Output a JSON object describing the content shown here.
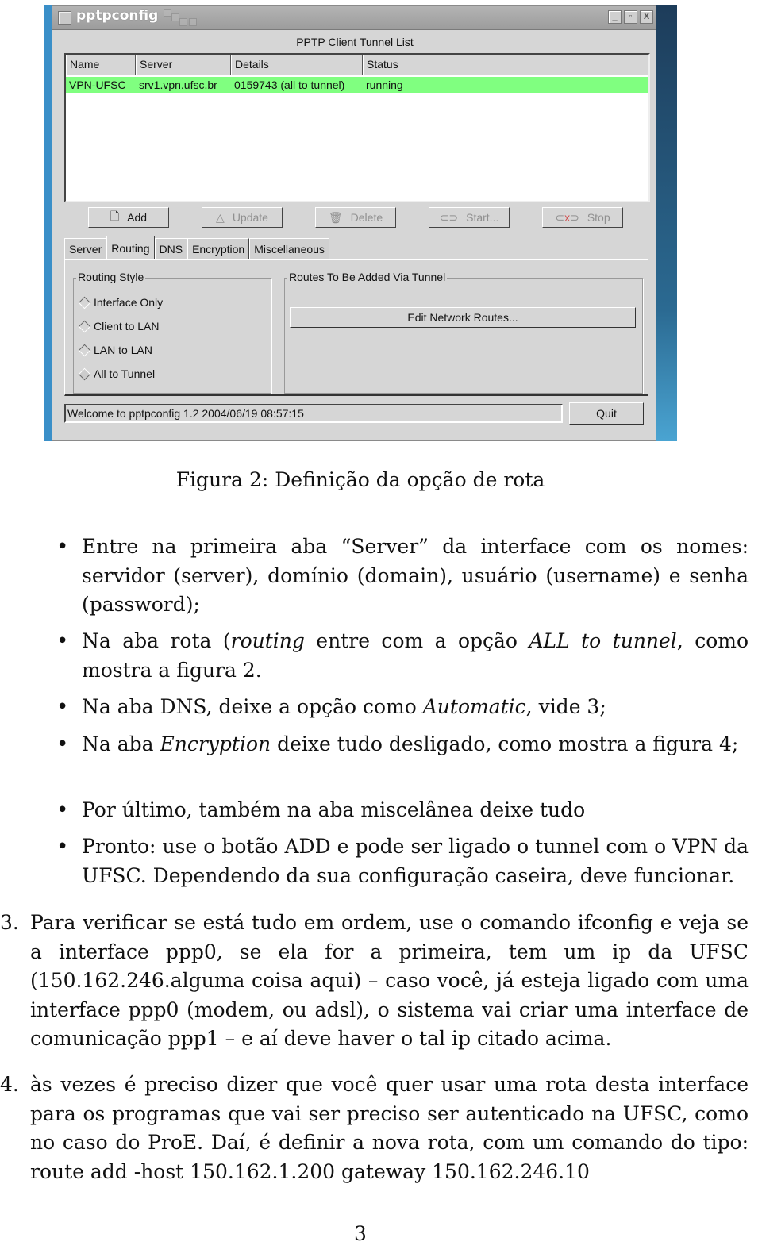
{
  "window": {
    "title": "pptpconfig",
    "list_title": "PPTP Client Tunnel List",
    "columns": [
      "Name",
      "Server",
      "Details",
      "Status"
    ],
    "rows": [
      {
        "name": "VPN-UFSC",
        "server": "srv1.vpn.ufsc.br",
        "details": "0159743 (all to tunnel)",
        "status": "running"
      }
    ],
    "row_highlight_color": "#80ff80",
    "buttons": {
      "add": "Add",
      "update": "Update",
      "delete": "Delete",
      "start": "Start...",
      "stop": "Stop"
    },
    "tabs": [
      "Server",
      "Routing",
      "DNS",
      "Encryption",
      "Miscellaneous"
    ],
    "active_tab": "Routing",
    "routing_style": {
      "label": "Routing Style",
      "options": [
        "Interface Only",
        "Client to LAN",
        "LAN to LAN",
        "All to Tunnel"
      ],
      "selected": "All to Tunnel"
    },
    "routes_group": {
      "label": "Routes To Be Added Via Tunnel",
      "edit_button": "Edit Network Routes..."
    },
    "status_text": "Welcome to pptpconfig 1.2 2004/06/19 08:57:15",
    "quit": "Quit"
  },
  "doc": {
    "caption": "Figura 2: Definição da opção de rota",
    "bullets": [
      {
        "pre": "Entre na primeira aba “Server” da interface com os nomes: servidor (server), domínio (domain), usuário (username) e senha (password);"
      },
      {
        "pre": "Na aba rota (",
        "em1": "routing",
        "mid": " entre com a opção ",
        "em2": "ALL to tunnel",
        "post": ", como mostra a figura 2."
      },
      {
        "pre": "Na aba DNS, deixe a opção como ",
        "em1": "Automatic",
        "post": ", vide 3;"
      },
      {
        "pre": "Na aba ",
        "em1": "Encryption",
        "post": " deixe tudo desligado, como mostra a figura 4;"
      },
      {
        "pre": "Por último, também na aba miscelânea deixe tudo"
      },
      {
        "pre": "Pronto: use o botão ADD e pode ser ligado o tunnel com o VPN da UFSC. Dependendo da sua configuração caseira, deve funcionar."
      }
    ],
    "items": [
      {
        "num": "3.",
        "text": "Para verificar se está tudo em ordem, use o comando ifconfig e veja se a interface ppp0, se ela for a primeira, tem um ip da UFSC (150.162.246.alguma coisa aqui) – caso você, já esteja ligado com uma interface ppp0 (modem, ou adsl), o sistema vai criar uma interface de comunicação ppp1 – e aí deve haver o tal ip citado acima."
      },
      {
        "num": "4.",
        "text": "às vezes é preciso dizer que você quer usar uma rota desta interface para os programas que vai ser preciso ser autenticado na UFSC, como no caso do ProE. Daí, é definir a nova rota, com um comando do tipo: route add -host 150.162.1.200 gateway 150.162.246.10"
      }
    ],
    "page_number": "3"
  }
}
